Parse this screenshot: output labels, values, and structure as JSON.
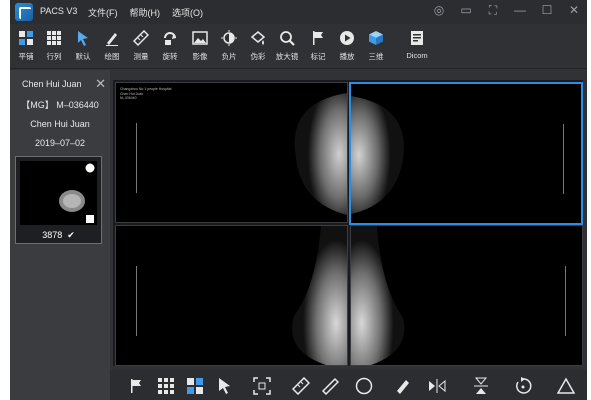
{
  "app": {
    "title": "PACS V3",
    "menu": [
      "文件(F)",
      "帮助(H)",
      "选项(O)"
    ]
  },
  "toolbar": {
    "items": [
      {
        "label": "平铺",
        "icon": "tile-grid-icon"
      },
      {
        "label": "行列",
        "icon": "rows-cols-grid-icon"
      },
      {
        "label": "默认",
        "icon": "pointer-arrow-icon"
      },
      {
        "label": "绘图",
        "icon": "pen-draw-icon"
      },
      {
        "label": "测量",
        "icon": "ruler-measure-icon"
      },
      {
        "label": "旋转",
        "icon": "rotate-icon"
      },
      {
        "label": "影像",
        "icon": "image-icon"
      },
      {
        "label": "负片",
        "icon": "invert-contrast-icon"
      },
      {
        "label": "伪彩",
        "icon": "pseudo-color-icon"
      },
      {
        "label": "放大镜",
        "icon": "magnifier-icon"
      },
      {
        "label": "标记",
        "icon": "flag-marker-icon"
      },
      {
        "label": "播放",
        "icon": "play-icon"
      },
      {
        "label": "三维",
        "icon": "cube-3d-icon"
      },
      {
        "label": "Dicom",
        "icon": "dicom-file-icon"
      }
    ]
  },
  "patient": {
    "name": "Chen Hui Juan",
    "modality_id": "【MG】 M–036440",
    "display_name": "Chen Hui Juan",
    "date": "2019–07–02"
  },
  "series": {
    "count": "3878",
    "check_icon": "check-icon"
  },
  "viewports": {
    "hospital": "Changzhou No.1 people Hospital",
    "patient": "Chen Hui Juan",
    "id": "M–036440",
    "border_active": "#2b8de3"
  },
  "bottom_tools": [
    "flag-marker-icon",
    "grid-9-icon",
    "tile-grid-icon",
    "pointer-arrow-icon",
    "fit-screen-icon",
    "ruler-measure-icon",
    "ruler-icon",
    "circle-icon",
    "pen-draw-icon",
    "flip-horizontal-icon",
    "flip-vertical-icon",
    "rotate-icon",
    "triangle-icon"
  ]
}
